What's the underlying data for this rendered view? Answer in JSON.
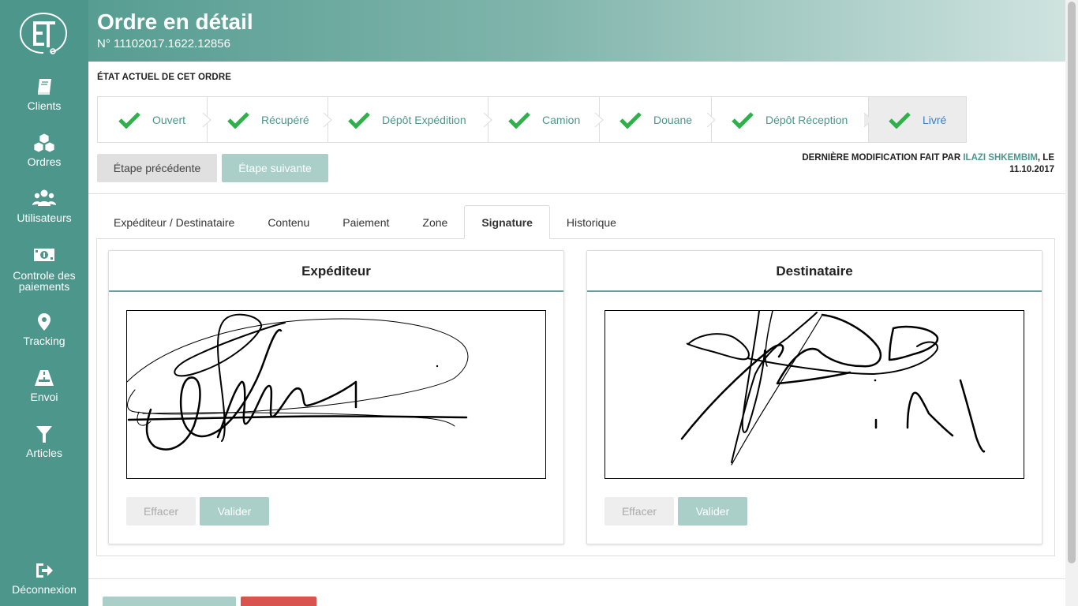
{
  "sidebar": {
    "items": [
      {
        "label": "Clients",
        "icon": "book-icon"
      },
      {
        "label": "Ordres",
        "icon": "cubes-icon"
      },
      {
        "label": "Utilisateurs",
        "icon": "users-icon"
      },
      {
        "label": "Controle des paiements",
        "icon": "money-icon"
      },
      {
        "label": "Tracking",
        "icon": "map-marker-icon"
      },
      {
        "label": "Envoi",
        "icon": "road-icon"
      },
      {
        "label": "Articles",
        "icon": "filter-icon"
      }
    ],
    "logout": {
      "label": "Déconnexion",
      "icon": "sign-out-icon"
    }
  },
  "header": {
    "title": "Ordre en détail",
    "order_number": "N° 11102017.1622.12856"
  },
  "status": {
    "section_title": "ÉTAT ACTUEL DE CET ORDRE",
    "steps": [
      {
        "label": "Ouvert",
        "done": true
      },
      {
        "label": "Récupéré",
        "done": true
      },
      {
        "label": "Dépôt Expédition",
        "done": true
      },
      {
        "label": "Camion",
        "done": true
      },
      {
        "label": "Douane",
        "done": true
      },
      {
        "label": "Dépôt Réception",
        "done": true
      },
      {
        "label": "Livré",
        "done": true,
        "active": true
      }
    ],
    "prev_label": "Étape précédente",
    "next_label": "Étape suivante",
    "last_modified_prefix": "DERNIÈRE MODIFICATION FAIT PAR",
    "last_modified_user": "ILAZI SHKEMBIM",
    "last_modified_sep": ", LE",
    "last_modified_date": "11.10.2017"
  },
  "tabs": [
    {
      "label": "Expéditeur / Destinataire"
    },
    {
      "label": "Contenu"
    },
    {
      "label": "Paiement"
    },
    {
      "label": "Zone"
    },
    {
      "label": "Signature",
      "active": true
    },
    {
      "label": "Historique"
    }
  ],
  "signature": {
    "sender": {
      "title": "Expéditeur",
      "clear_label": "Effacer",
      "validate_label": "Valider"
    },
    "recipient": {
      "title": "Destinataire",
      "clear_label": "Effacer",
      "validate_label": "Valider"
    }
  },
  "colors": {
    "sidebar": "#4d968c",
    "accent": "#4d968c",
    "check": "#2eb04a",
    "active_step_text": "#3e7ec0",
    "disabled_button": "#aacfc9",
    "danger": "#d9534f"
  }
}
